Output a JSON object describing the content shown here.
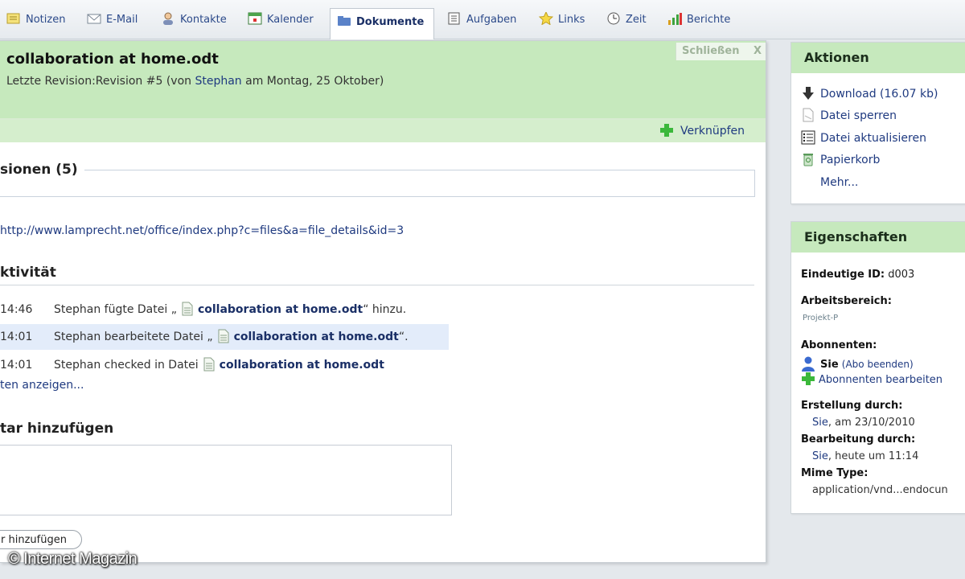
{
  "tabs": [
    {
      "label": "Notizen",
      "icon": "notes-icon"
    },
    {
      "label": "E-Mail",
      "icon": "mail-icon"
    },
    {
      "label": "Kontakte",
      "icon": "contacts-icon"
    },
    {
      "label": "Kalender",
      "icon": "calendar-icon"
    },
    {
      "label": "Dokumente",
      "icon": "documents-icon",
      "active": true
    },
    {
      "label": "Aufgaben",
      "icon": "tasks-icon"
    },
    {
      "label": "Links",
      "icon": "star-icon"
    },
    {
      "label": "Zeit",
      "icon": "clock-icon"
    },
    {
      "label": "Berichte",
      "icon": "bar-chart-icon"
    }
  ],
  "document": {
    "close_label": "Schließen",
    "close_x": "X",
    "title": "collaboration at home.odt",
    "revision_prefix": "Letzte Revision:Revision #5 (von ",
    "revision_user": "Stephan",
    "revision_suffix": " am Montag, 25 Oktober)",
    "link_label": "Verknüpfen",
    "versions_title": "sionen (5)",
    "url": "http://www.lamprecht.net/office/index.php?c=files&a=file_details&id=3"
  },
  "activity": {
    "title": "ktivität",
    "rows": [
      {
        "time": "14:46",
        "prefix": "Stephan fügte Datei „",
        "doc": "collaboration at home.odt",
        "suffix": "“ hinzu."
      },
      {
        "time": "14:01",
        "prefix": "Stephan bearbeitete Datei „",
        "doc": "collaboration at home.odt",
        "suffix": "“."
      },
      {
        "time": "14:01",
        "prefix": "Stephan checked in Datei",
        "doc": "collaboration at home.odt",
        "suffix": ""
      }
    ],
    "show_more": "ten anzeigen..."
  },
  "comment": {
    "title": "tar hinzufügen",
    "button": "r hinzufügen"
  },
  "actions": {
    "title": "Aktionen",
    "items": [
      {
        "label": "Download (16.07 kb)",
        "icon": "download-icon"
      },
      {
        "label": "Datei sperren",
        "icon": "lock-file-icon"
      },
      {
        "label": "Datei aktualisieren",
        "icon": "update-list-icon"
      },
      {
        "label": "Papierkorb",
        "icon": "trash-icon"
      },
      {
        "label": "Mehr...",
        "icon": ""
      }
    ]
  },
  "properties": {
    "title": "Eigenschaften",
    "id_label": "Eindeutige ID:",
    "id_value": "d003",
    "workspace_label": "Arbeitsbereich:",
    "workspace_value": "Projekt-P",
    "subscribers_label": "Abonnenten:",
    "subscriber_name": "Sie",
    "subscriber_action": "(Abo beenden)",
    "edit_subscribers": "Abonnenten bearbeiten",
    "created_label": "Erstellung durch:",
    "created_user": "Sie",
    "created_value": ", am 23/10/2010",
    "edited_label": "Bearbeitung durch:",
    "edited_user": "Sie",
    "edited_value": ", heute um 11:14",
    "mime_label": "Mime Type:",
    "mime_value": "application/vnd...endocun"
  },
  "watermark": "© Internet Magazin",
  "colors": {
    "header_green": "#c6e9bd",
    "link_blue": "#1f3a80",
    "highlight_row": "#e3ecfa"
  }
}
